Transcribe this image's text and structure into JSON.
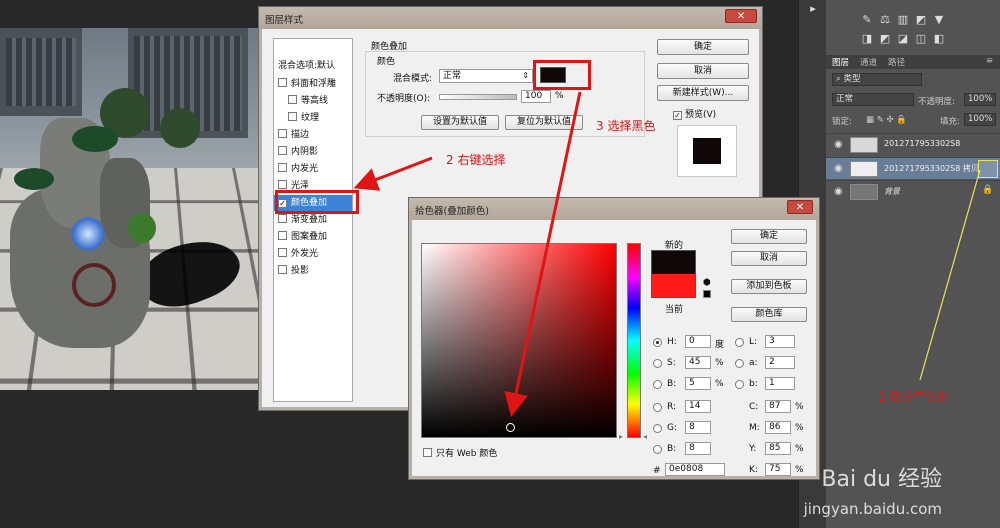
{
  "layer_style_dialog": {
    "title": "图层样式",
    "styles_header": "样式",
    "blend_options": "混合选项:默认",
    "style_items": [
      "斜面和浮雕",
      "等高线",
      "纹理",
      "描边",
      "内阴影",
      "内发光",
      "光泽",
      "颜色叠加",
      "渐变叠加",
      "图案叠加",
      "外发光",
      "投影"
    ],
    "active_item": "颜色叠加",
    "section_title": "颜色叠加",
    "subsection": "颜色",
    "blend_mode_label": "混合模式:",
    "blend_mode_value": "正常",
    "opacity_label": "不透明度(O):",
    "opacity_value": "100",
    "opacity_unit": "%",
    "opacity_percent": 100,
    "btn_set_default": "设置为默认值",
    "btn_reset_default": "复位为默认值",
    "btn_ok": "确定",
    "btn_cancel": "取消",
    "btn_new_style": "新建样式(W)...",
    "preview_label": "预览(V)",
    "overlay_color": "#0e0808"
  },
  "color_picker_dialog": {
    "title": "拾色器(叠加颜色)",
    "new_label": "新的",
    "current_label": "当前",
    "btn_ok": "确定",
    "btn_cancel": "取消",
    "btn_add_swatches": "添加到色板",
    "btn_color_libraries": "颜色库",
    "web_only_label": "只有 Web 颜色",
    "fields": {
      "H": "0",
      "H_unit": "度",
      "S": "45",
      "S_unit": "%",
      "B": "5",
      "B_unit": "%",
      "R": "14",
      "G": "8",
      "Bl": "8",
      "L": "3",
      "a": "2",
      "b": "1",
      "C": "87",
      "M": "86",
      "Y": "85",
      "K": "75",
      "cmyk_unit": "%"
    },
    "hex_label": "#",
    "hex_value": "0e0808",
    "new_color": "#0e0808",
    "current_color": "#ff1a1a"
  },
  "layers_panel": {
    "tabs": [
      "图层",
      "通道",
      "路径"
    ],
    "kind_filter": "类型",
    "blend_mode": "正常",
    "opacity_label": "不透明度:",
    "opacity_value": "100%",
    "lock_label": "锁定:",
    "fill_label": "填充:",
    "fill_value": "100%",
    "layers": [
      {
        "name": "2012717953302S8",
        "selected": false
      },
      {
        "name": "2012717953302S8 拷贝",
        "selected": true
      },
      {
        "name": "背景",
        "selected": false
      }
    ]
  },
  "annotations": {
    "step1": "1 双击空白处",
    "step2": "2 右键选择",
    "step3": "3 选择黑色"
  },
  "watermark": {
    "brand": "Bai du 经验",
    "url": "jingyan.baidu.com"
  },
  "colors": {
    "accent_red": "#e01414",
    "selection_blue": "#3b83d6",
    "annotation_yellow": "#e8e45a"
  }
}
